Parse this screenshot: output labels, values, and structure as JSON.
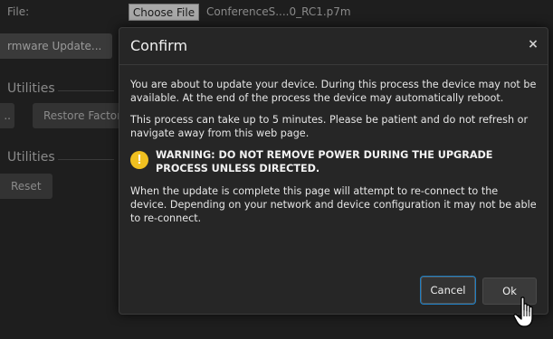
{
  "background": {
    "file_label": "File:",
    "choose_file_label": "Choose File",
    "file_name": "ConferenceS....0_RC1.p7m",
    "firmware_update_label": "rmware Update...",
    "section1_title": "Utilities",
    "dots_label": "..",
    "restore_label": "Restore Factor",
    "section2_title": "Utilities",
    "reset_label": "Reset"
  },
  "modal": {
    "title": "Confirm",
    "close_label": "×",
    "para1": "You are about to update your device. During this process the device may not be available. At the end of the process the device may automatically reboot.",
    "para2": "This process can take up to 5 minutes. Please be patient and do not refresh or navigate away from this web page.",
    "warning_icon_glyph": "!",
    "warning": "WARNING: DO NOT REMOVE POWER DURING THE UPGRADE PROCESS UNLESS DIRECTED.",
    "para3": "When the update is complete this page will attempt to re-connect to the device. Depending on your network and device configuration it may not be able to re-connect.",
    "cancel_label": "Cancel",
    "ok_label": "Ok"
  },
  "colors": {
    "warning_icon": "#f0c020",
    "focus_outline": "#1e7fc4"
  },
  "icons": {
    "close": "close-icon",
    "warning": "warning-icon",
    "cursor": "hand-pointer-icon"
  }
}
